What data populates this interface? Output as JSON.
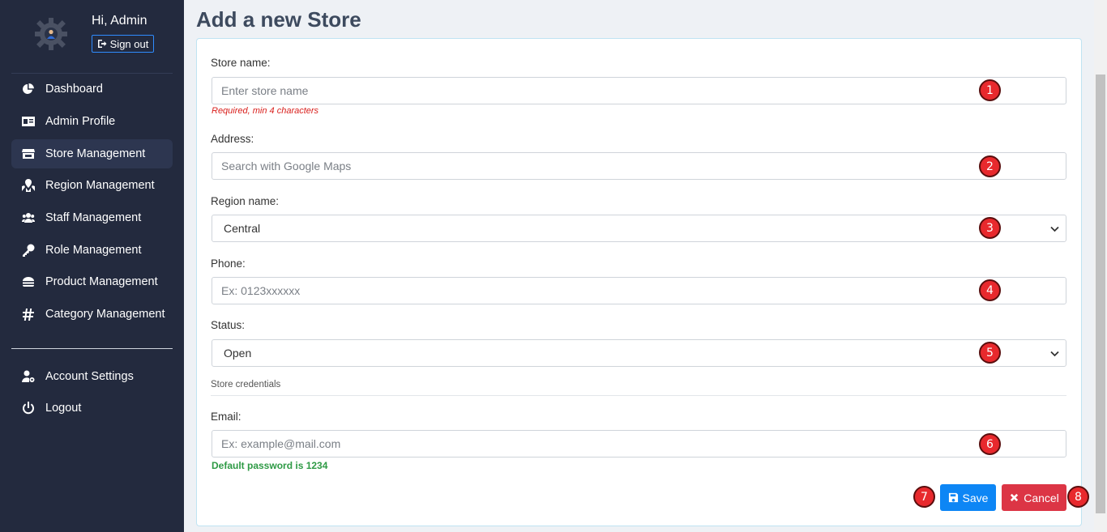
{
  "sidebar": {
    "greeting": "Hi, Admin",
    "sign_out": "Sign out",
    "menu": [
      {
        "label": "Dashboard",
        "icon": "pie-chart-icon"
      },
      {
        "label": "Admin Profile",
        "icon": "id-card-icon"
      },
      {
        "label": "Store Management",
        "icon": "store-icon",
        "active": true
      },
      {
        "label": "Region Management",
        "icon": "map-marked-icon"
      },
      {
        "label": "Staff Management",
        "icon": "users-icon"
      },
      {
        "label": "Role Management",
        "icon": "key-icon"
      },
      {
        "label": "Product Management",
        "icon": "burger-icon"
      },
      {
        "label": "Category Management",
        "icon": "hashtag-icon"
      }
    ],
    "bottom": [
      {
        "label": "Account Settings",
        "icon": "user-cog-icon"
      },
      {
        "label": "Logout",
        "icon": "power-icon"
      }
    ]
  },
  "page": {
    "title": "Add a new Store"
  },
  "form": {
    "store_name": {
      "label": "Store name:",
      "placeholder": "Enter store name",
      "hint": "Required, min 4 characters"
    },
    "address": {
      "label": "Address:",
      "placeholder": "Search with Google Maps"
    },
    "region": {
      "label": "Region name:",
      "value": "Central"
    },
    "phone": {
      "label": "Phone:",
      "placeholder": "Ex: 0123xxxxxx"
    },
    "status": {
      "label": "Status:",
      "value": "Open"
    },
    "section": "Store credentials",
    "email": {
      "label": "Email:",
      "placeholder": "Ex: example@mail.com",
      "hint": "Default password is 1234"
    },
    "save_label": "Save",
    "cancel_label": "Cancel"
  },
  "badges": [
    "1",
    "2",
    "3",
    "4",
    "5",
    "6",
    "7",
    "8"
  ],
  "colors": {
    "sidebar_bg": "#232a3e",
    "primary": "#0d86f5",
    "danger": "#dc3545",
    "badge": "#e8292d",
    "success_text": "#2e9a45",
    "error_text": "#d9201d"
  }
}
